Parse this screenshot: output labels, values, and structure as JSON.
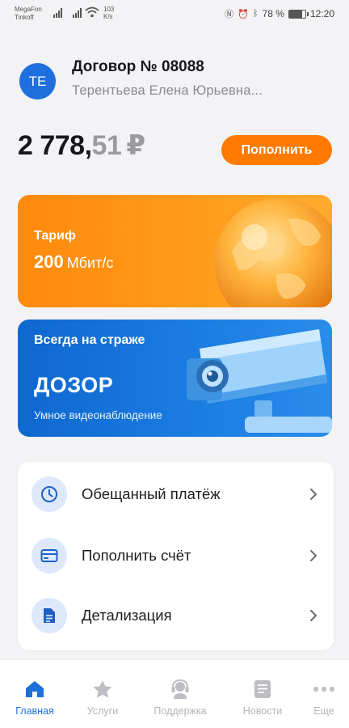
{
  "status_bar": {
    "carrier_line1": "MegaFon",
    "carrier_line2": "Tinkoff",
    "speed_value": "103",
    "speed_unit": "K/s",
    "battery_percent": "78 %",
    "battery_level": 0.78,
    "time": "12:20"
  },
  "account": {
    "avatar_initials": "ТЕ",
    "contract_title": "Договор № 08088",
    "holder_name": "Терентьева Елена Юрьевна..."
  },
  "balance": {
    "integer": "2 778,",
    "fraction": "51",
    "currency": "₽",
    "topup_label": "Пополнить"
  },
  "banners": {
    "tariff": {
      "label": "Тариф",
      "speed_value": "200",
      "speed_unit": "Мбит/с"
    },
    "dozor": {
      "pre_title": "Всегда на страже",
      "title": "ДОЗОР",
      "subtitle": "Умное видеонаблюдение"
    }
  },
  "menu": {
    "items": [
      {
        "label": "Обещанный платёж",
        "icon": "clock-icon"
      },
      {
        "label": "Пополнить счёт",
        "icon": "card-icon"
      },
      {
        "label": "Детализация",
        "icon": "document-icon"
      }
    ]
  },
  "bottom_nav": {
    "items": [
      {
        "label": "Главная",
        "icon": "home-icon",
        "active": true
      },
      {
        "label": "Услуги",
        "icon": "star-icon",
        "active": false
      },
      {
        "label": "Поддержка",
        "icon": "headset-icon",
        "active": false
      },
      {
        "label": "Новости",
        "icon": "news-icon",
        "active": false
      },
      {
        "label": "Еще",
        "icon": "more-icon",
        "active": false
      }
    ]
  },
  "colors": {
    "accent_orange": "#ff7a00",
    "accent_blue": "#1e6fdc",
    "icon_bg": "#dde8fb"
  }
}
